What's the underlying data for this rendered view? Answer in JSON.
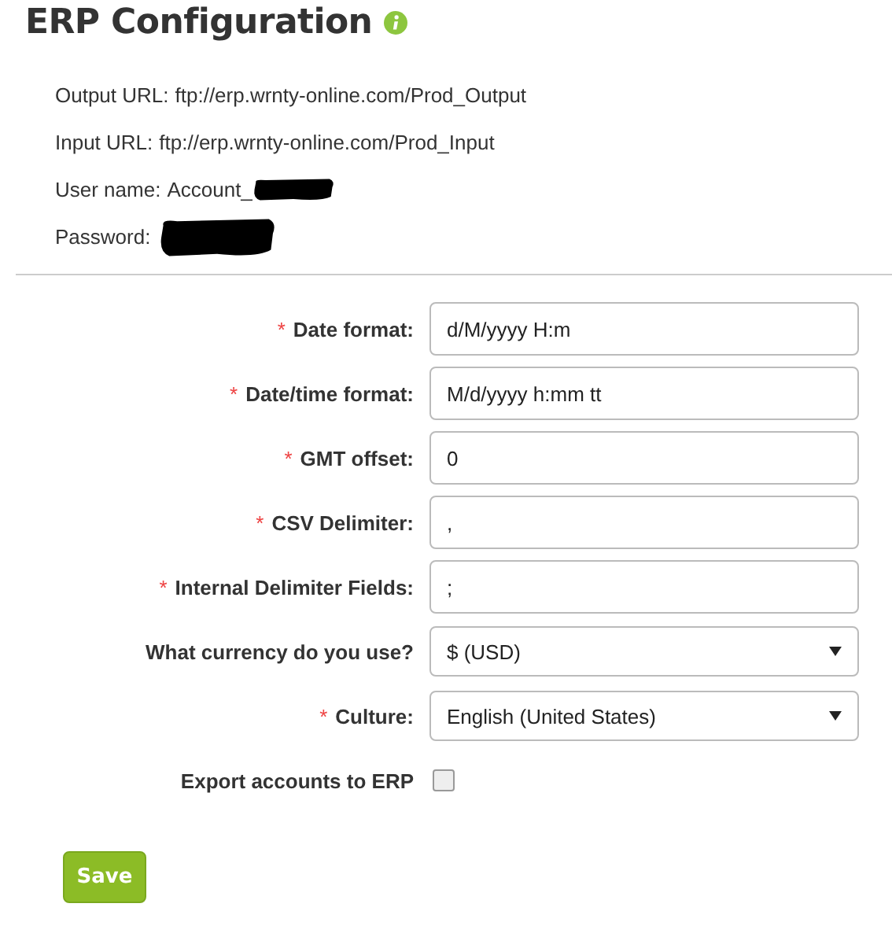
{
  "title": "ERP Configuration",
  "info": [
    {
      "label": "Output URL:",
      "value": "ftp://erp.wrnty-online.com/Prod_Output"
    },
    {
      "label": "Input URL:",
      "value": "ftp://erp.wrnty-online.com/Prod_Input"
    },
    {
      "label": "User name:",
      "value": "Account_",
      "redacted": true
    },
    {
      "label": "Password:",
      "redacted": true
    }
  ],
  "fields": [
    {
      "kind": "text",
      "mark": "*",
      "label": "Date format:",
      "value": "d/M/yyyy H:m"
    },
    {
      "kind": "text",
      "mark": "*",
      "label": "Date/time format:",
      "value": "M/d/yyyy h:mm tt"
    },
    {
      "kind": "text",
      "mark": "*",
      "label": "GMT offset:",
      "value": "0"
    },
    {
      "kind": "text",
      "mark": "*",
      "label": "CSV Delimiter:",
      "value": ","
    },
    {
      "kind": "text",
      "mark": "*",
      "label": "Internal Delimiter Fields:",
      "value": ";"
    },
    {
      "kind": "select",
      "label": "What currency do you use?",
      "value": "$ (USD)"
    },
    {
      "kind": "select",
      "mark": "*",
      "label": "Culture:",
      "value": "English (United States)"
    },
    {
      "kind": "checkbox",
      "label": "Export accounts to ERP",
      "checked": false
    }
  ],
  "save_button": "Save"
}
